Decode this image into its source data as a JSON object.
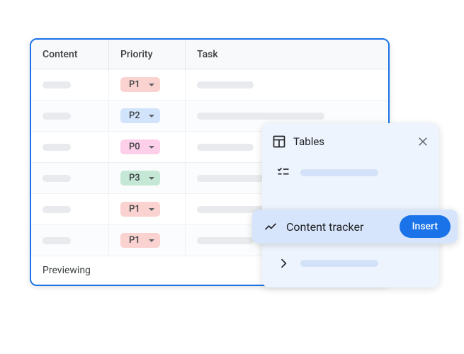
{
  "table": {
    "headers": {
      "content": "Content",
      "priority": "Priority",
      "task": "Task"
    },
    "rows": [
      {
        "priority": "P1",
        "chip_class": "chip-p1"
      },
      {
        "priority": "P2",
        "chip_class": "chip-p2"
      },
      {
        "priority": "P0",
        "chip_class": "chip-p0"
      },
      {
        "priority": "P3",
        "chip_class": "chip-p3"
      },
      {
        "priority": "P1",
        "chip_class": "chip-p1"
      },
      {
        "priority": "P1",
        "chip_class": "chip-p1"
      }
    ],
    "footer": "Previewing"
  },
  "panel": {
    "title": "Tables",
    "highlight_label": "Content tracker",
    "insert_label": "Insert"
  }
}
